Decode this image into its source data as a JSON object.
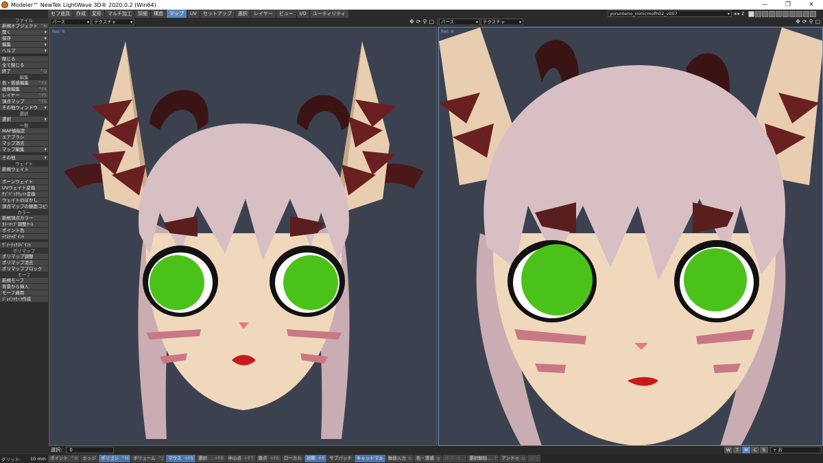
{
  "window": {
    "title": "Modeler™ NewTek LightWave 3D® 2020.0.2 (Win64)",
    "min": "—",
    "max": "❐",
    "close": "✕"
  },
  "menubar": {
    "label": "",
    "tabs": [
      "セフ道具",
      "作成",
      "変形",
      "マルチ加工",
      "詳細",
      "構造",
      "マップ",
      "UV",
      "セットアップ",
      "選択",
      "レイヤー",
      "ビュー",
      "I/O",
      "ユーティリティ"
    ],
    "active_tab": "マップ",
    "object": "yorunteno_minicmofh02_v007",
    "layer_num": "2"
  },
  "sidebar": [
    {
      "section": "ファイル"
    },
    {
      "label": "新規オブジェクト",
      "sc": "^N"
    },
    {
      "label": "開く",
      "dd": true
    },
    {
      "label": "保存",
      "dd": true
    },
    {
      "label": "編集",
      "dd": true
    },
    {
      "label": "ヘルプ",
      "dd": true
    },
    {
      "gap": true
    },
    {
      "label": "閉じる"
    },
    {
      "label": "全て閉じる"
    },
    {
      "label": "終了",
      "sc": "^Q"
    },
    {
      "section": "編集"
    },
    {
      "label": "色・質感編集",
      "sc": "^F3"
    },
    {
      "label": "画像編集",
      "sc": "^F4"
    },
    {
      "label": "レイヤー",
      "sc": "^F5"
    },
    {
      "label": "頂点マップ",
      "sc": "^F6"
    },
    {
      "label": "その他ウィンドウ",
      "dd": true
    },
    {
      "section": "選択"
    },
    {
      "label": "選択",
      "dd": true
    },
    {
      "section": "一般"
    },
    {
      "label": "MAP値指定"
    },
    {
      "label": "エアブラシ"
    },
    {
      "label": "マップ消去"
    },
    {
      "label": "マップ編集",
      "dd": true
    },
    {
      "gap": true
    },
    {
      "label": "その他",
      "dd": true
    },
    {
      "section": "ウェイト"
    },
    {
      "label": "新規ウェイト"
    },
    {
      "label": "",
      "dim": true
    },
    {
      "label": "ボーンウェイト"
    },
    {
      "label": "UVウェイト変換"
    },
    {
      "label": "ｻﾌﾞﾊﾟｯﾁｳｪｲﾄ変換"
    },
    {
      "label": "ウェイトのぼかし"
    },
    {
      "label": "頂点マップの鏡面コピー"
    },
    {
      "section": "カラー"
    },
    {
      "label": "新規頂点カラー"
    },
    {
      "label": "ｶﾗｰﾏｯﾌﾟ調整ﾂｰﾙ"
    },
    {
      "label": "ポイント色"
    },
    {
      "label": "ﾃｸｽﾁｬﾎﾟｲﾝﾄ"
    },
    {
      "gap": true
    },
    {
      "label": "ｳﾞｧｰﾃｯｸｽﾍﾟｲﾝﾄ"
    },
    {
      "section": "ポリマップ"
    },
    {
      "label": "ポリマップ調整"
    },
    {
      "label": "ポリマップ消去"
    },
    {
      "label": "ポリマップブロック"
    },
    {
      "section": "モーフ"
    },
    {
      "label": "新規モーフ"
    },
    {
      "label": "背景から挿入"
    },
    {
      "label": "モーフ適用"
    },
    {
      "label": "ｼﾞｮｲﾝﾄﾓｰﾌ作成"
    }
  ],
  "viewports": [
    {
      "view": "パース",
      "mode": "テクスチャ",
      "rel": "Rel: 8"
    },
    {
      "view": "パース",
      "mode": "テクスチャ",
      "rel": "Rel: 8"
    }
  ],
  "statusbar": {
    "select_label": "選択:",
    "select_value": "0",
    "wtmcs": [
      "W",
      "T",
      "M",
      "C",
      "S"
    ],
    "wtmcs_on": "M",
    "plus": "+",
    "units": "お"
  },
  "grid": {
    "label": "グリッド:",
    "value": "10 mm"
  },
  "modebar": [
    {
      "label": "ポイント",
      "k": "^G"
    },
    {
      "label": "エッジ",
      "k": ""
    },
    {
      "label": "ポリゴン",
      "k": "^H",
      "hl": true
    },
    {
      "label": "ボリューム",
      "k": "^J"
    },
    {
      "label": "マウス",
      "k": "+F5",
      "hl": true
    },
    {
      "label": "選択",
      "k": "…+F8"
    },
    {
      "label": "中心点",
      "k": "+F7"
    },
    {
      "label": "原点",
      "k": "+F6"
    },
    {
      "label": "ローカル",
      "k": ""
    },
    {
      "label": "対称",
      "k": "+Y",
      "hl": true
    },
    {
      "label": "サブパッチ",
      "k": ""
    },
    {
      "label": "キャットマル",
      "k": "",
      "hl": true
    },
    {
      "label": "数値入力",
      "k": "n"
    },
    {
      "label": "色・質感",
      "k": "q"
    },
    {
      "label": "ﾒﾀﾞﾃﾞｰﾀ…",
      "k": "",
      "dim": true
    },
    {
      "label": "選択解除…",
      "k": "?"
    },
    {
      "label": "アンドゥ",
      "k": "u"
    },
    {
      "label": "ﾘﾄﾞｩ",
      "k": "",
      "dim": true
    }
  ]
}
